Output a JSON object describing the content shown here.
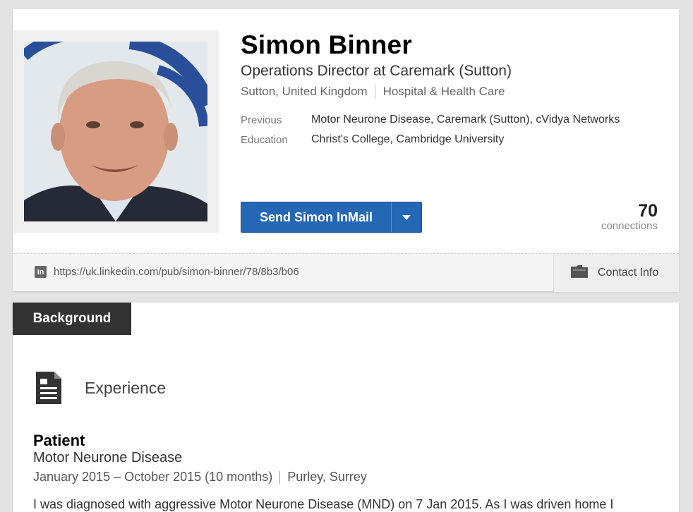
{
  "profile": {
    "name": "Simon Binner",
    "headline": "Operations Director at Caremark (Sutton)",
    "location": "Sutton, United Kingdom",
    "industry": "Hospital & Health Care",
    "previous_label": "Previous",
    "previous_value": "Motor Neurone Disease, Caremark (Sutton), cVidya Networks",
    "education_label": "Education",
    "education_value": "Christ's College, Cambridge University",
    "inmail_button": "Send Simon InMail",
    "connections_count": "70",
    "connections_label": "connections",
    "url": "https://uk.linkedin.com/pub/simon-binner/78/8b3/b06",
    "linkedin_icon_text": "in",
    "contact_info": "Contact Info"
  },
  "background": {
    "tab_label": "Background",
    "experience_heading": "Experience",
    "job": {
      "title": "Patient",
      "company": "Motor Neurone Disease",
      "dates": "January 2015 – October 2015 (10 months)",
      "location": "Purley, Surrey",
      "description": "I was diagnosed with aggressive Motor Neurone Disease (MND) on 7 Jan 2015. As I was driven home I"
    }
  },
  "colors": {
    "primary_button": "#2467b4",
    "tab_dark": "#333333",
    "page_bg": "#e3e3e3"
  },
  "icons": {
    "linkedin": "linkedin-icon",
    "contact": "folder-icon",
    "experience": "document-icon",
    "dropdown": "caret-down-icon"
  }
}
